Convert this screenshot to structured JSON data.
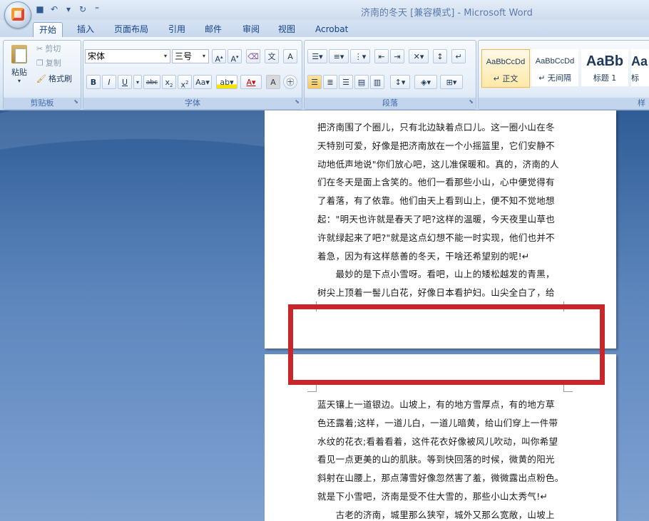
{
  "window": {
    "title": "济南的冬天 [兼容模式] - Microsoft Word"
  },
  "tabs": [
    "开始",
    "插入",
    "页面布局",
    "引用",
    "邮件",
    "审阅",
    "视图",
    "Acrobat"
  ],
  "clipboard": {
    "paste": "粘贴",
    "cut": "剪切",
    "copy": "复制",
    "format_painter": "格式刷",
    "label": "剪贴板"
  },
  "font": {
    "name": "宋体",
    "size": "三号",
    "label": "字体"
  },
  "paragraph": {
    "label": "段落"
  },
  "styles": {
    "label": "样",
    "items": [
      {
        "sample": "AaBbCcDd",
        "name": "↵ 正文"
      },
      {
        "sample": "AaBbCcDd",
        "name": "↵ 无间隔"
      },
      {
        "sample": "AaBb",
        "name": "标题 1"
      },
      {
        "sample": "Aa",
        "name": "标"
      }
    ]
  },
  "page1_lines": [
    "把济南围了个圈儿，只有北边缺着点口儿。这一圈小山在冬",
    "天特别可爱，好像是把济南放在一个小摇篮里，它们安静不",
    "动地低声地说\"你们放心吧，这儿准保暖和。真的，济南的人",
    "们在冬天是面上含笑的。他们一看那些小山，心中便觉得有",
    "了着落，有了依靠。他们由天上看到山上，便不知不觉地想",
    "起：\"明天也许就是春天了吧?这样的温暖，今天夜里山草也",
    "许就绿起来了吧?\"就是这点幻想不能一时实现，他们也并不",
    "着急，因为有这样慈善的冬天，干啥还希望别的呢!↵",
    "　　最妙的是下点小雪呀。看吧，山上的矮松越发的青黑，",
    "树尖上顶着一髻儿白花，好像日本看护妇。山尖全白了，给"
  ],
  "page2_lines": [
    "蓝天镶上一道银边。山坡上，有的地方雪厚点，有的地方草",
    "色还露着;这样，一道儿白，一道儿暗黄，给山们穿上一件带",
    "水纹的花衣;看着看着，这件花衣好像被风儿吹动，叫你希望",
    "看见一点更美的山的肌肤。等到快回落的时候，微黄的阳光",
    "斜射在山腰上，那点薄雪好像忽然害了羞，微微露出点粉色。",
    "就是下小雪吧，济南是受不住大雪的，那些小山太秀气!↵",
    "　　古老的济南，城里那么狭窄，城外又那么宽敞，山坡上"
  ]
}
